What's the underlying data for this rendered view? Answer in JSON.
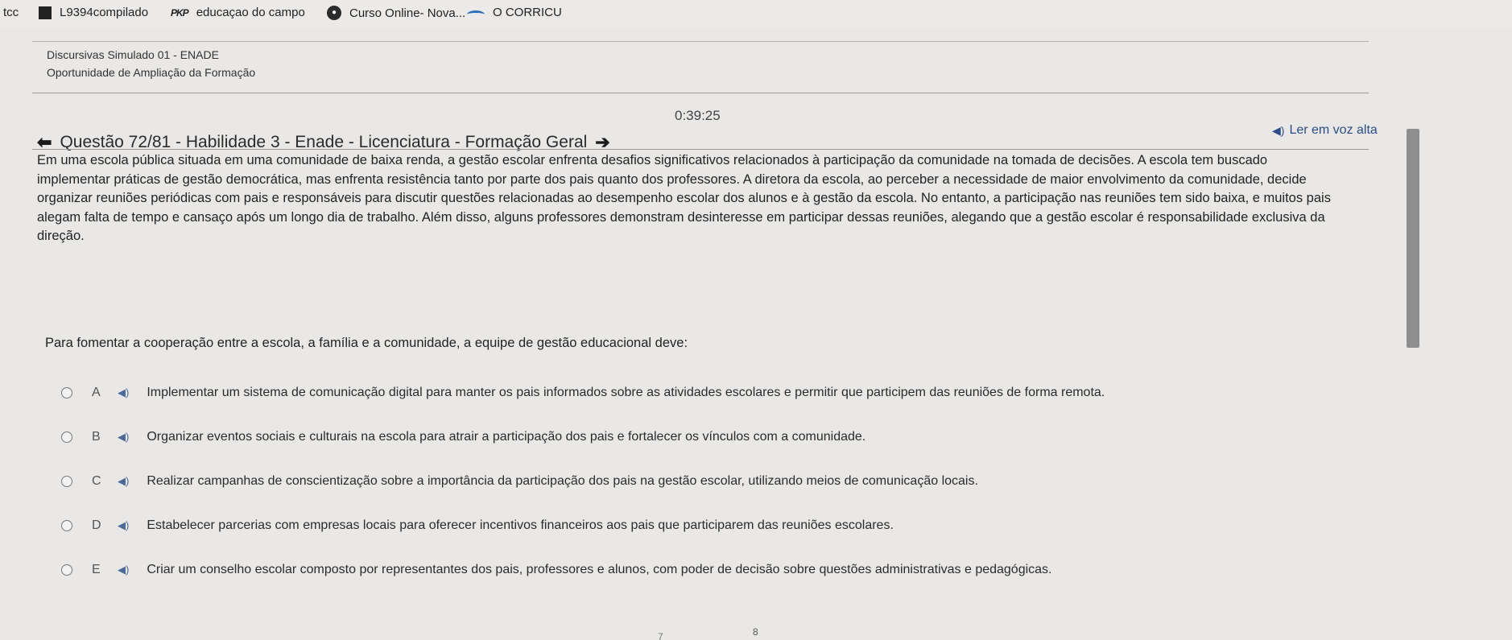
{
  "bookmarks": [
    {
      "label": "tcc",
      "icon": "folder-icon"
    },
    {
      "label": "L9394compilado",
      "icon": "document-icon"
    },
    {
      "label": "educaçao do campo",
      "icon": "pkp-icon",
      "icon_text": "PKP"
    },
    {
      "label": "Curso Online- Nova...",
      "icon": "site-circle-icon"
    },
    {
      "label": "O CORRICU",
      "icon": "bird-icon"
    }
  ],
  "breadcrumb": {
    "line1": "Discursivas Simulado 01 - ENADE",
    "line2": "Oportunidade de Ampliação da Formação"
  },
  "timer": "0:39:25",
  "read_aloud": {
    "label": "Ler em voz alta",
    "icon": "speaker-icon"
  },
  "question": {
    "title": "Questão 72/81 - Habilidade 3 - Enade - Licenciatura - Formação Geral",
    "statement_lines": [
      "Em uma escola pública situada em uma comunidade de baixa renda, a gestão escolar enfrenta desafios significativos relacionados à participação da comunidade na tomada de decisões. A escola tem buscado",
      "implementar práticas de gestão democrática, mas enfrenta resistência tanto por parte dos pais quanto dos professores. A diretora da escola, ao perceber a necessidade de maior envolvimento da comunidade, decide",
      "organizar reuniões periódicas com pais e responsáveis para discutir questões relacionadas ao desempenho escolar dos alunos e à gestão da escola. No entanto, a participação nas reuniões tem sido baixa, e muitos pais",
      "alegam falta de tempo e cansaço após um longo dia de trabalho. Além disso, alguns professores demonstram desinteresse em participar dessas reuniões, alegando que a gestão escolar é responsabilidade exclusiva da",
      "direção."
    ],
    "prompt": "Para fomentar a cooperação entre a escola, a família e a comunidade, a equipe de gestão educacional deve:",
    "options": [
      {
        "letter": "A",
        "text": "Implementar um sistema de comunicação digital para manter os pais informados sobre as atividades escolares e permitir que participem das reuniões de forma remota."
      },
      {
        "letter": "B",
        "text": "Organizar eventos sociais e culturais na escola para atrair a participação dos pais e fortalecer os vínculos com a comunidade."
      },
      {
        "letter": "C",
        "text": "Realizar campanhas de conscientização sobre a importância da participação dos pais na gestão escolar, utilizando meios de comunicação locais."
      },
      {
        "letter": "D",
        "text": "Estabelecer parcerias com empresas locais para oferecer incentivos financeiros aos pais que participarem das reuniões escolares."
      },
      {
        "letter": "E",
        "text": "Criar um conselho escolar composto por representantes dos pais, professores e alunos, com poder de decisão sobre questões administrativas e pedagógicas."
      }
    ]
  },
  "footer": {
    "page_a": "7",
    "page_b": "8"
  }
}
